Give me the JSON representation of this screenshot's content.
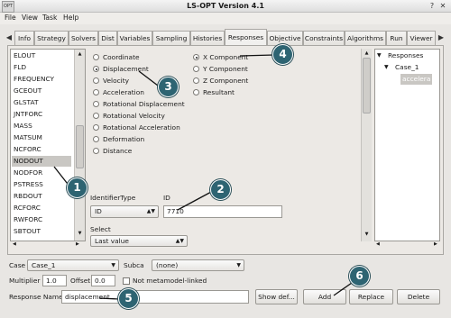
{
  "window": {
    "title": "LS-OPT Version 4.1"
  },
  "menubar": [
    {
      "label": "File"
    },
    {
      "label": "View"
    },
    {
      "label": "Task"
    },
    {
      "label": "Help"
    }
  ],
  "tabs": [
    {
      "label": "Info"
    },
    {
      "label": "Strategy"
    },
    {
      "label": "Solvers"
    },
    {
      "label": "Dist"
    },
    {
      "label": "Variables"
    },
    {
      "label": "Sampling"
    },
    {
      "label": "Histories"
    },
    {
      "label": "Responses",
      "active": true
    },
    {
      "label": "Objective"
    },
    {
      "label": "Constraints"
    },
    {
      "label": "Algorithms"
    },
    {
      "label": "Run"
    },
    {
      "label": "Viewer"
    }
  ],
  "result_list": {
    "items": [
      "ELOUT",
      "FLD",
      "FREQUENCY",
      "GCEOUT",
      "GLSTAT",
      "JNTFORC",
      "MASS",
      "MATSUM",
      "NCFORC",
      "NODOUT",
      "NODFOR",
      "PSTRESS",
      "RBDOUT",
      "RCFORC",
      "RWFORC",
      "SBTOUT"
    ],
    "selected": "NODOUT"
  },
  "quantity_radios": [
    {
      "label": "Coordinate",
      "checked": false
    },
    {
      "label": "Displacement",
      "checked": true
    },
    {
      "label": "Velocity",
      "checked": false
    },
    {
      "label": "Acceleration",
      "checked": false
    },
    {
      "label": "Rotational Displacement",
      "checked": false
    },
    {
      "label": "Rotational Velocity",
      "checked": false
    },
    {
      "label": "Rotational Acceleration",
      "checked": false
    },
    {
      "label": "Deformation",
      "checked": false
    },
    {
      "label": "Distance",
      "checked": false
    }
  ],
  "component_radios": [
    {
      "label": "X Component",
      "checked": true
    },
    {
      "label": "Y Component",
      "checked": false
    },
    {
      "label": "Z Component",
      "checked": false
    },
    {
      "label": "Resultant",
      "checked": false
    }
  ],
  "identifier": {
    "type_label": "IdentifierType",
    "type_value": "ID",
    "id_label": "ID",
    "id_value": "7710"
  },
  "select": {
    "label": "Select",
    "value": "Last value"
  },
  "response_tree": {
    "root": "Responses",
    "case": "Case_1",
    "item": "accelera"
  },
  "bottom": {
    "case_label": "Case",
    "case_value": "Case_1",
    "subcase_label": "Subca",
    "subcase_value": "(none)",
    "multiplier_label": "Multiplier",
    "multiplier_value": "1.0",
    "offset_label": "Offset",
    "offset_value": "0.0",
    "not_metamodel_label": "Not metamodel-linked",
    "response_name_label": "Response Name",
    "response_name_value": "displacement",
    "show_def_label": "Show def...",
    "add_label": "Add",
    "replace_label": "Replace",
    "delete_label": "Delete"
  },
  "callouts": [
    "1",
    "2",
    "3",
    "4",
    "5",
    "6"
  ],
  "colors": {
    "callout": "#2e6472"
  },
  "icons": {
    "app": "ls-opt-logo-icon",
    "help": "help-icon",
    "close": "close-icon"
  }
}
